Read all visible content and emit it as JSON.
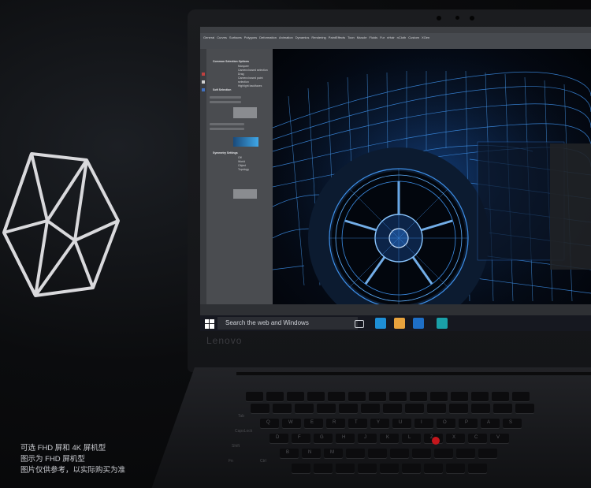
{
  "brand": {
    "logo_text": "Lenovo"
  },
  "maya": {
    "panel_headers": [
      "Common Selection Options",
      "Soft Selection",
      "Symmetry Settings"
    ],
    "panel_options": [
      "Marquee",
      "Camera based selection",
      "Drag",
      "Camera based paint selection",
      "Highlight backfaces",
      "Off",
      "World",
      "Object",
      "Topology"
    ],
    "menu_items": [
      "General",
      "Curves",
      "Surfaces",
      "Polygons",
      "Deformation",
      "Animation",
      "Dynamics",
      "Rendering",
      "PaintEffects",
      "Toon",
      "Muscle",
      "Fluids",
      "Fur",
      "nHair",
      "nCloth",
      "Custom",
      "XGen"
    ]
  },
  "taskbar": {
    "search_placeholder": "Search the web and Windows",
    "icon_colors": [
      "#1e8fd6",
      "#e8a33d",
      "#1e6fc6",
      "#1aa0a8"
    ]
  },
  "keyboard": {
    "row_labels": [
      "Tab",
      "CapsLock",
      "Shift",
      "Fn",
      "Ctrl"
    ],
    "letters": [
      "Q",
      "W",
      "E",
      "R",
      "T",
      "Y",
      "U",
      "I",
      "O",
      "P",
      "A",
      "S",
      "D",
      "F",
      "G",
      "H",
      "J",
      "K",
      "L",
      "Z",
      "X",
      "C",
      "V",
      "B",
      "N",
      "M"
    ]
  },
  "caption": {
    "line1": "可选 FHD 屏和 4K 屏机型",
    "line2": "图示为 FHD 屏机型",
    "line3": "图片仅供参考，以实际购买为准"
  },
  "colors": {
    "trackpoint": "#c4161c",
    "wireframe": "#3d8fe8"
  }
}
